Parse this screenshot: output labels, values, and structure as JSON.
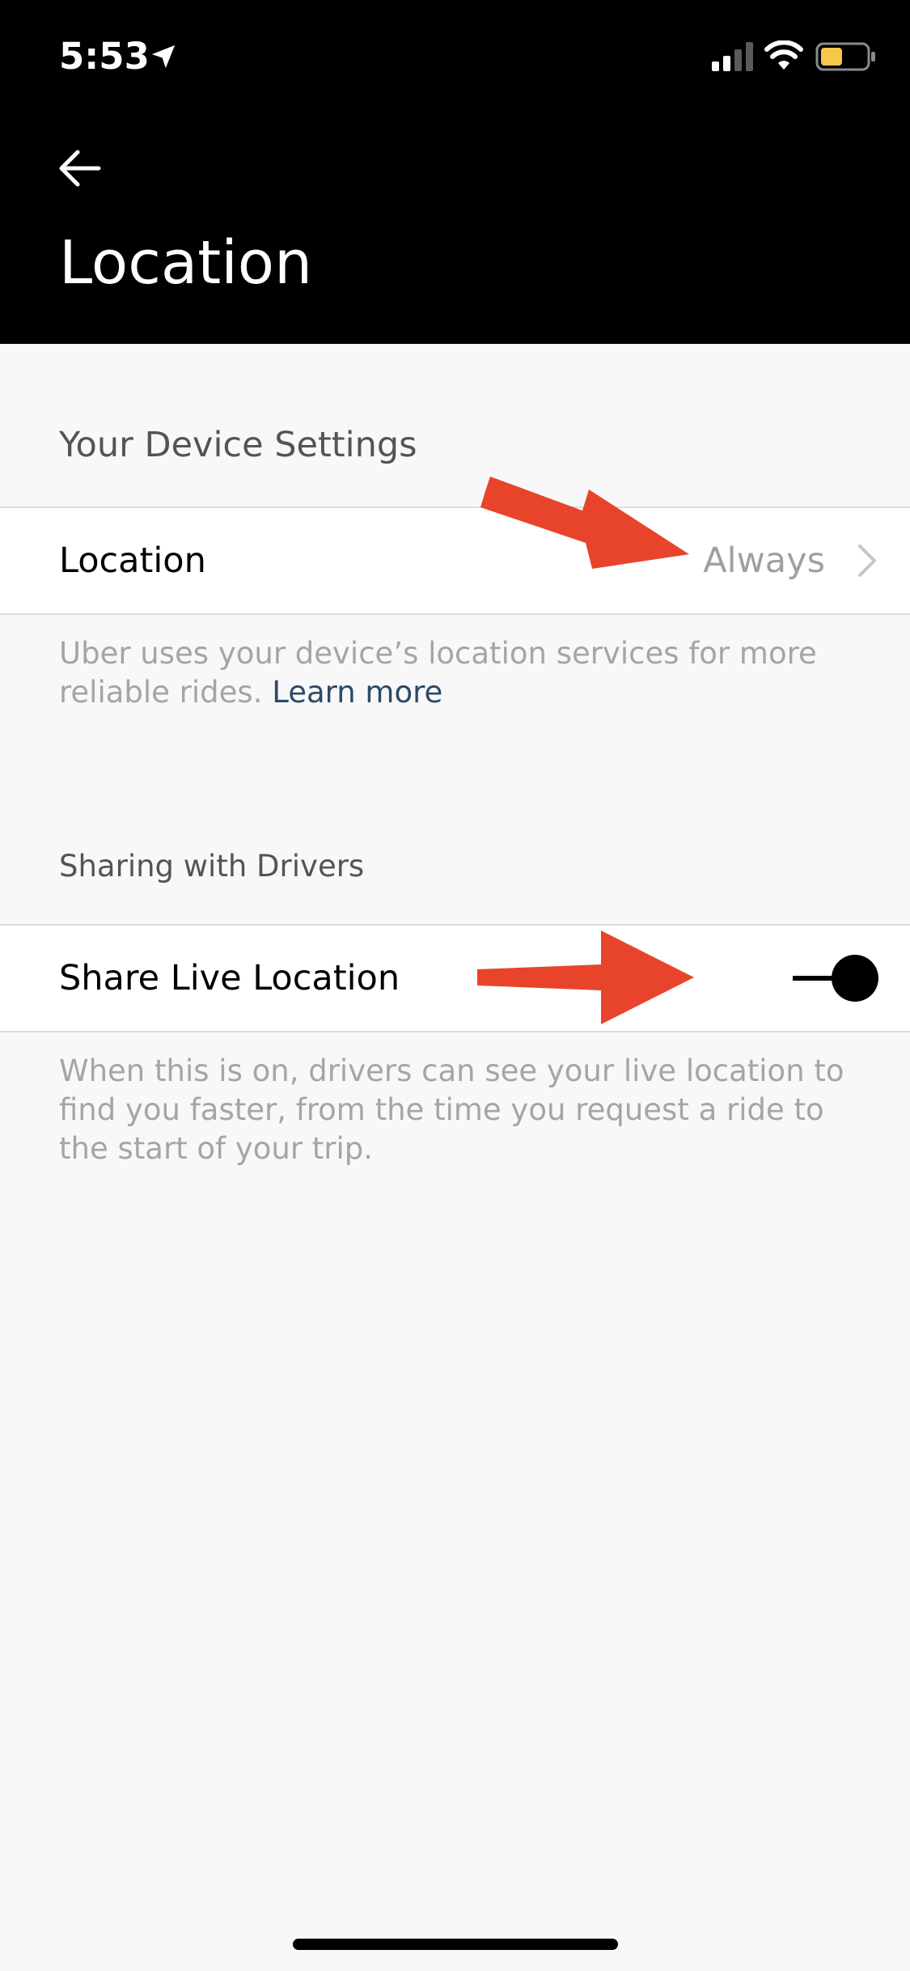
{
  "status_bar": {
    "time": "5:53",
    "battery_color": "#f5c84c"
  },
  "header": {
    "back_icon": "arrow-left-icon",
    "title": "Location"
  },
  "device_settings": {
    "section_title": "Your Device Settings",
    "row": {
      "label": "Location",
      "value": "Always",
      "icon": "chevron-right-icon"
    },
    "helper_text": "Uber uses your device’s location services for more reliable rides.",
    "learn_more": "Learn more"
  },
  "sharing": {
    "section_title": "Sharing with Drivers",
    "row": {
      "label": "Share Live Location",
      "toggle_on": true
    },
    "helper_text": "When this is on, drivers can see your live location to find you faster, from the time you request a ride to the start of your trip."
  },
  "annotation_color": "#e8442b"
}
